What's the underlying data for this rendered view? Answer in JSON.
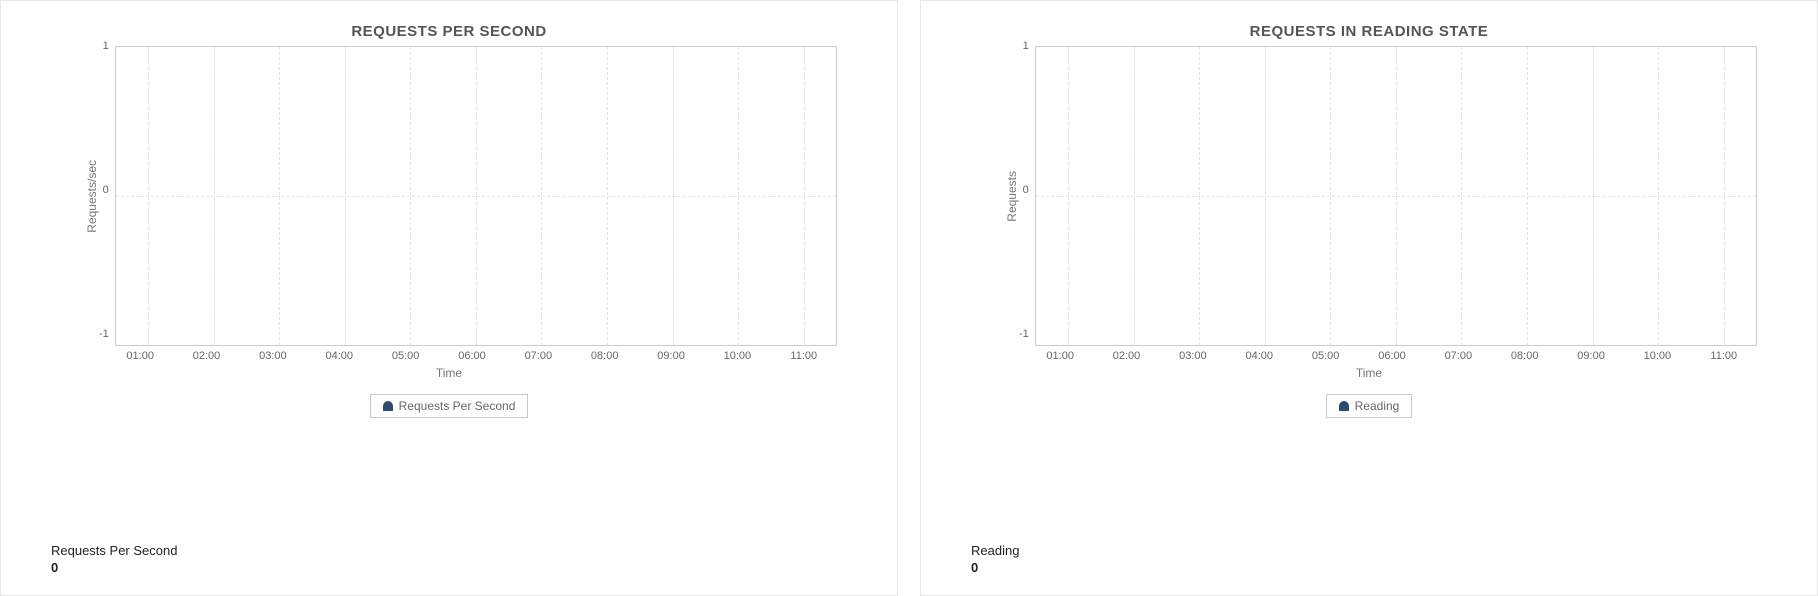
{
  "panels": [
    {
      "title": "REQUESTS PER SECOND",
      "ylabel": "Requests/sec",
      "xlabel": "Time",
      "legend_label": "Requests Per Second",
      "legend_color": "#2d4a73",
      "stat_label": "Requests Per Second",
      "stat_value": "0",
      "y_ticks": [
        "1",
        "0",
        "-1"
      ],
      "x_ticks": [
        "01:00",
        "02:00",
        "03:00",
        "04:00",
        "05:00",
        "06:00",
        "07:00",
        "08:00",
        "09:00",
        "10:00",
        "11:00"
      ]
    },
    {
      "title": "REQUESTS IN READING STATE",
      "ylabel": "Requests",
      "xlabel": "Time",
      "legend_label": "Reading",
      "legend_color": "#2d4a73",
      "stat_label": "Reading",
      "stat_value": "0",
      "y_ticks": [
        "1",
        "0",
        "-1"
      ],
      "x_ticks": [
        "01:00",
        "02:00",
        "03:00",
        "04:00",
        "05:00",
        "06:00",
        "07:00",
        "08:00",
        "09:00",
        "10:00",
        "11:00"
      ]
    }
  ],
  "chart_data": [
    {
      "type": "line",
      "title": "REQUESTS PER SECOND",
      "xlabel": "Time",
      "ylabel": "Requests/sec",
      "ylim": [
        -1,
        1
      ],
      "categories": [
        "01:00",
        "02:00",
        "03:00",
        "04:00",
        "05:00",
        "06:00",
        "07:00",
        "08:00",
        "09:00",
        "10:00",
        "11:00"
      ],
      "series": [
        {
          "name": "Requests Per Second",
          "values": []
        }
      ]
    },
    {
      "type": "line",
      "title": "REQUESTS IN READING STATE",
      "xlabel": "Time",
      "ylabel": "Requests",
      "ylim": [
        -1,
        1
      ],
      "categories": [
        "01:00",
        "02:00",
        "03:00",
        "04:00",
        "05:00",
        "06:00",
        "07:00",
        "08:00",
        "09:00",
        "10:00",
        "11:00"
      ],
      "series": [
        {
          "name": "Reading",
          "values": []
        }
      ]
    }
  ]
}
